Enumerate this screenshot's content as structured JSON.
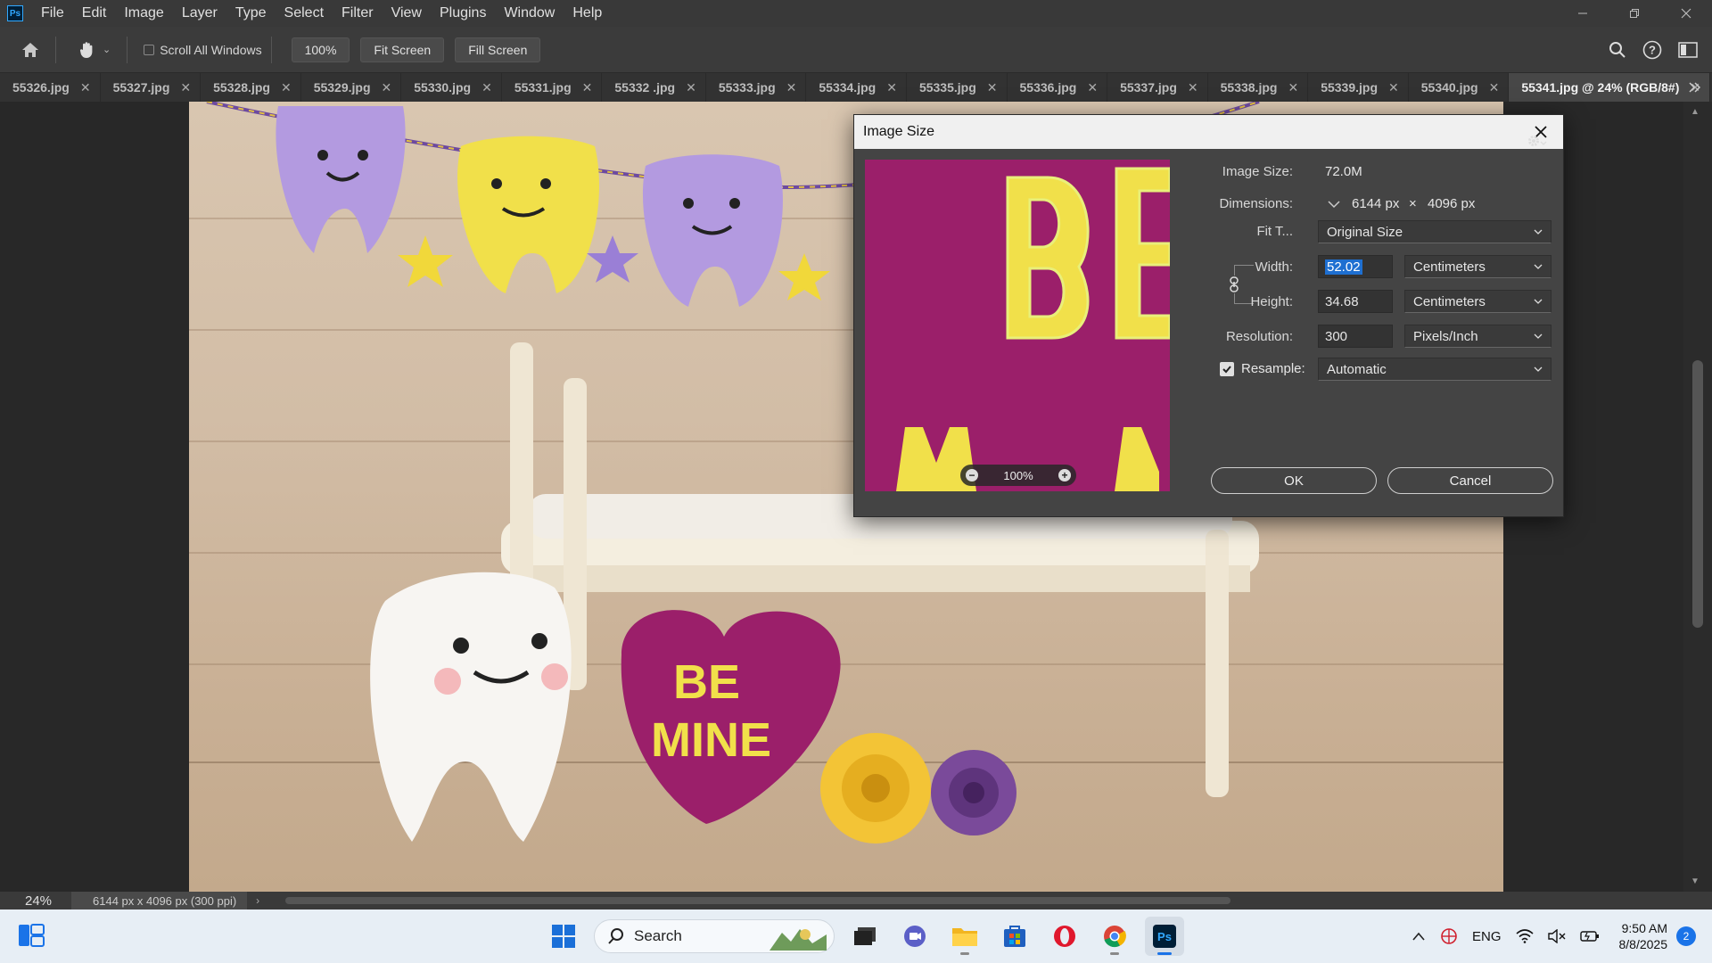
{
  "menubar": {
    "logo": "Ps",
    "items": [
      "File",
      "Edit",
      "Image",
      "Layer",
      "Type",
      "Select",
      "Filter",
      "View",
      "Plugins",
      "Window",
      "Help"
    ]
  },
  "optionsbar": {
    "scroll_all_windows": "Scroll All Windows",
    "zoom_value": "100%",
    "fit_screen": "Fit Screen",
    "fill_screen": "Fill Screen"
  },
  "tabs": [
    {
      "label": "55326.jpg",
      "active": false
    },
    {
      "label": "55327.jpg",
      "active": false
    },
    {
      "label": "55328.jpg",
      "active": false
    },
    {
      "label": "55329.jpg",
      "active": false
    },
    {
      "label": "55330.jpg",
      "active": false
    },
    {
      "label": "55331.jpg",
      "active": false
    },
    {
      "label": "55332 .jpg",
      "active": false
    },
    {
      "label": "55333.jpg",
      "active": false
    },
    {
      "label": "55334.jpg",
      "active": false
    },
    {
      "label": "55335.jpg",
      "active": false
    },
    {
      "label": "55336.jpg",
      "active": false
    },
    {
      "label": "55337.jpg",
      "active": false
    },
    {
      "label": "55338.jpg",
      "active": false
    },
    {
      "label": "55339.jpg",
      "active": false
    },
    {
      "label": "55340.jpg",
      "active": false
    },
    {
      "label": "55341.jpg @ 24% (RGB/8#)",
      "active": true
    }
  ],
  "canvas": {
    "heart_text_1": "BE",
    "heart_text_2": "MINE"
  },
  "statusbar": {
    "zoom": "24%",
    "doc_info": "6144 px x 4096 px (300 ppi)"
  },
  "dialog": {
    "title": "Image Size",
    "preview_zoom": "100%",
    "image_size_label": "Image Size:",
    "image_size_value": "72.0M",
    "dimensions_label": "Dimensions:",
    "dim_width": "6144 px",
    "dim_x": "×",
    "dim_height": "4096 px",
    "fit_to_label": "Fit T...",
    "fit_to_value": "Original Size",
    "width_label": "Width:",
    "width_value": "52.02",
    "width_unit": "Centimeters",
    "height_label": "Height:",
    "height_value": "34.68",
    "height_unit": "Centimeters",
    "resolution_label": "Resolution:",
    "resolution_value": "300",
    "resolution_unit": "Pixels/Inch",
    "resample_label": "Resample:",
    "resample_checked": true,
    "resample_value": "Automatic",
    "ok_label": "OK",
    "cancel_label": "Cancel"
  },
  "taskbar": {
    "search_label": "Search",
    "lang": "ENG",
    "time": "9:50 AM",
    "date": "8/8/2025",
    "notification_count": "2"
  },
  "colors": {
    "accent": "#1a73e8",
    "heart": "#9b1f6a",
    "text_yellow": "#f1e04a"
  }
}
